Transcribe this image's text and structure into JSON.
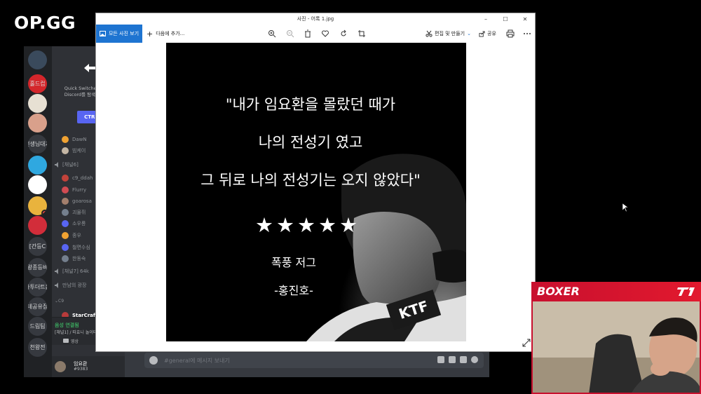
{
  "brand": {
    "logo_text": "OP.GG"
  },
  "photos_app": {
    "window_title": "사진 - 어록 1.jpg",
    "window_controls": [
      "–",
      "☐",
      "✕"
    ],
    "toolbar": {
      "all_photos": "모든 사진 보기",
      "add_to": "다음에 추가...",
      "edit_create": "편집 및 만들기",
      "share": "공유"
    },
    "image_text": {
      "line1": "\"내가 임요환을 몰랐던 때가",
      "line2": "나의 전성기 였고",
      "line3": "그 뒤로 나의 전성기는 오지 않았다\"",
      "stars": "★★★★★",
      "line5": "폭풍 저그",
      "line6": "-홍진호-",
      "logo": "KTF"
    }
  },
  "discord": {
    "quick_switcher": {
      "text": "Quick Switcher를 사용하여 Discord를 탐색해 보세요. 키",
      "button": "CTRL"
    },
    "servers": [
      {
        "label": "",
        "color": "#3a4a5c",
        "badge": false
      },
      {
        "label": "홀드컵",
        "color": "#d4262b",
        "badge": false
      },
      {
        "label": "",
        "color": "#e7e0d3",
        "badge": false
      },
      {
        "label": "",
        "color": "#d9a08b",
        "badge": false
      },
      {
        "label": "선생님대기",
        "color": "#36393f",
        "badge": false
      },
      {
        "label": "",
        "color": "#2fa8e0",
        "badge": false
      },
      {
        "label": "",
        "color": "#ffffff",
        "badge": false
      },
      {
        "label": "",
        "color": "#e9b33d",
        "badge": true
      },
      {
        "label": "",
        "color": "#d22d3a",
        "badge": false
      },
      {
        "label": "[간등C",
        "color": "#36393f",
        "badge": false
      },
      {
        "label": "왕종등비",
        "color": "#36393f",
        "badge": false
      },
      {
        "label": "아투더트롤",
        "color": "#36393f",
        "badge": false
      },
      {
        "label": "테공유집",
        "color": "#36393f",
        "badge": false
      },
      {
        "label": "드림팀",
        "color": "#36393f",
        "badge": false
      },
      {
        "label": "천왕전",
        "color": "#36393f",
        "badge": false
      }
    ],
    "channel_items": [
      {
        "kind": "user",
        "text": "DawN",
        "color": "#f0a232"
      },
      {
        "kind": "user",
        "text": "빔케이",
        "color": "#c4b6a4"
      },
      {
        "kind": "channel",
        "text": "[채널6]",
        "color": "#8e9297"
      },
      {
        "kind": "user",
        "text": "c9_ddah",
        "color": "#c2423a"
      },
      {
        "kind": "user",
        "text": "Flurry",
        "color": "#d14b52"
      },
      {
        "kind": "user",
        "text": "goarosa",
        "color": "#a37f6d"
      },
      {
        "kind": "user",
        "text": "괴물쥐",
        "color": "#747f8d"
      },
      {
        "kind": "user",
        "text": "소우룡",
        "color": "#5865f2"
      },
      {
        "kind": "user",
        "text": "종우",
        "color": "#f0a232"
      },
      {
        "kind": "user",
        "text": "철면수심",
        "color": "#5865f2"
      },
      {
        "kind": "user",
        "text": "한동숙",
        "color": "#747f8d"
      },
      {
        "kind": "channel",
        "text": "[채널7] 64k",
        "color": "#8e9297"
      },
      {
        "kind": "channel",
        "text": "만남의 광장",
        "color": "#8e9297"
      },
      {
        "kind": "category",
        "text": "C9",
        "color": "#8e9297"
      },
      {
        "kind": "user",
        "text": "StarCraft",
        "color": "#b83b3b"
      }
    ],
    "voice": {
      "status": "음성 연결됨",
      "channel": "[채널1] / 따효니 놀이터",
      "video_label": "영상"
    },
    "user": {
      "name": "임요환",
      "tag": "#9383"
    },
    "message_placeholder": "#general에 메시지 보내기",
    "input_icons": [
      "gift-icon",
      "gif-icon",
      "sticker-icon",
      "emoji-icon"
    ]
  },
  "stream_overlay": {
    "streamer_name": "BOXER",
    "team_logo": "T1",
    "accent_color": "#c8102e"
  }
}
